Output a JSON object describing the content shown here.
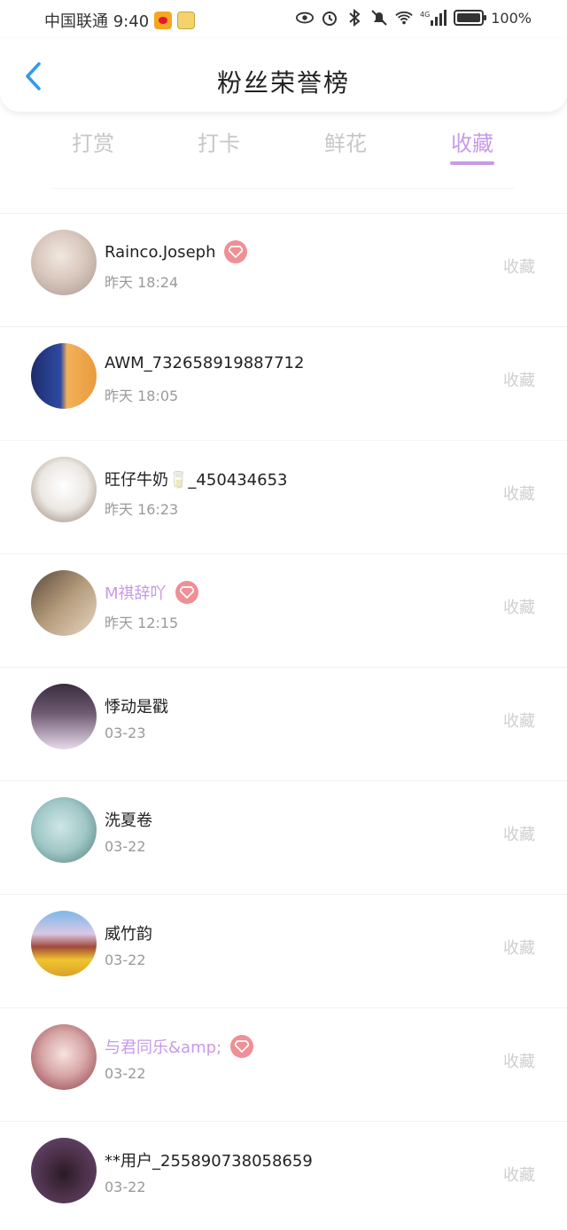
{
  "status_bar": {
    "carrier_time": "中国联通 9:40",
    "network": "4G",
    "battery_level": 1.0,
    "battery_text": "100%"
  },
  "header": {
    "title": "粉丝荣誉榜",
    "back_icon": "chevron-left-icon",
    "accent": "#2f9be8"
  },
  "tabs": [
    {
      "label": "打赏",
      "active": false
    },
    {
      "label": "打卡",
      "active": false
    },
    {
      "label": "鲜花",
      "active": false
    },
    {
      "label": "收藏",
      "active": true
    }
  ],
  "colors": {
    "accent": "#c79ae8",
    "vip_badge": "#f08f95",
    "muted": "#9a9a9a",
    "action": "#cfcfcf"
  },
  "fans": [
    {
      "name": "Rainco.Joseph",
      "time": "昨天 18:24",
      "vip": true,
      "action": "收藏"
    },
    {
      "name": "AWM_732658919887712",
      "time": "昨天 18:05",
      "vip": false,
      "action": "收藏"
    },
    {
      "name": "旺仔牛奶🥛_450434653",
      "time": "昨天 16:23",
      "vip": false,
      "action": "收藏"
    },
    {
      "name": "M祺辞吖",
      "time": "昨天 12:15",
      "vip": true,
      "action": "收藏"
    },
    {
      "name": "悸动是戳",
      "time": "03-23",
      "vip": false,
      "action": "收藏"
    },
    {
      "name": "洗夏卷",
      "time": "03-22",
      "vip": false,
      "action": "收藏"
    },
    {
      "name": "威竹韵",
      "time": "03-22",
      "vip": false,
      "action": "收藏"
    },
    {
      "name": "与君同乐&amp;",
      "time": "03-22",
      "vip": true,
      "action": "收藏"
    },
    {
      "name": "**用户_255890738058659",
      "time": "03-22",
      "vip": false,
      "action": "收藏"
    }
  ]
}
